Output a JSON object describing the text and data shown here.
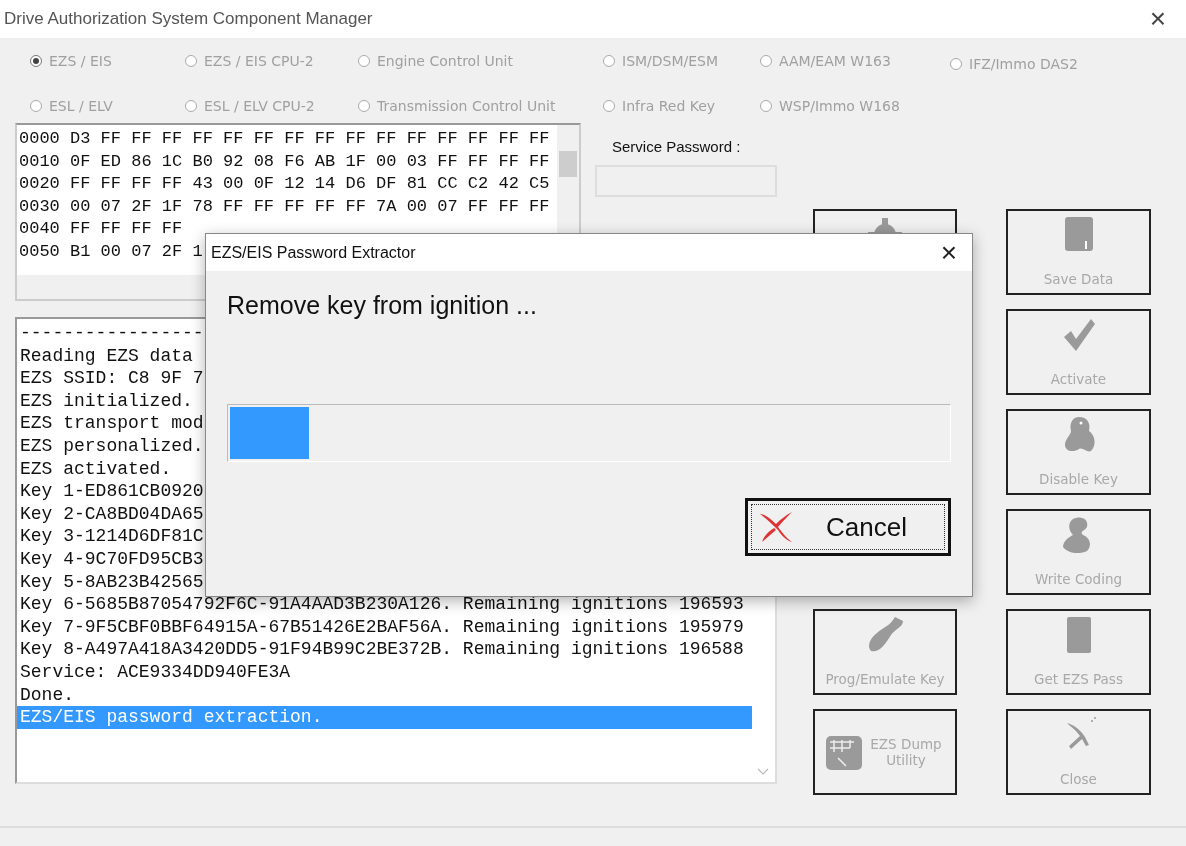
{
  "window": {
    "title": "Drive Authorization System Component Manager",
    "close": "×"
  },
  "modules": [
    {
      "label": "EZS / EIS",
      "selected": true,
      "disabled": true
    },
    {
      "label": "EZS / EIS CPU-2",
      "selected": false,
      "disabled": true
    },
    {
      "label": "Engine Control Unit",
      "selected": false,
      "disabled": true
    },
    {
      "label": "ISM/DSM/ESM",
      "selected": false,
      "disabled": true
    },
    {
      "label": "AAM/EAM W163",
      "selected": false,
      "disabled": true
    },
    {
      "label": "IFZ/Immo DAS2",
      "selected": false,
      "disabled": true
    },
    {
      "label": "ESL / ELV",
      "selected": false,
      "disabled": true
    },
    {
      "label": "ESL / ELV CPU-2",
      "selected": false,
      "disabled": true
    },
    {
      "label": "Transmission Control Unit",
      "selected": false,
      "disabled": true
    },
    {
      "label": "Infra Red Key",
      "selected": false,
      "disabled": true
    },
    {
      "label": "WSP/Immo W168",
      "selected": false,
      "disabled": true
    }
  ],
  "hex_dump": [
    "0000 D3 FF FF FF FF FF FF FF FF FF FF FF FF FF FF FF",
    "0010 0F ED 86 1C B0 92 08 F6 AB 1F 00 03 FF FF FF FF",
    "0020 FF FF FF FF 43 00 0F 12 14 D6 DF 81 CC C2 42 C5",
    "0030 00 07 2F 1F 78 FF FF FF FF FF 7A 00 07 FF FF FF",
    "0040 FF FF FF FF",
    "0050 B1 00 07 2F 1"
  ],
  "service_password": {
    "label": "Service Password :"
  },
  "log": [
    {
      "text": "-----------------",
      "selected": false
    },
    {
      "text": "Reading EZS data",
      "selected": false
    },
    {
      "text": "EZS SSID: C8 9F 7",
      "selected": false
    },
    {
      "text": "EZS initialized.",
      "selected": false
    },
    {
      "text": "EZS transport mod",
      "selected": false
    },
    {
      "text": "EZS personalized.",
      "selected": false
    },
    {
      "text": "EZS activated.",
      "selected": false
    },
    {
      "text": "Key 1-ED861CB0920",
      "selected": false
    },
    {
      "text": "Key 2-CA8BD04DA65",
      "selected": false
    },
    {
      "text": "Key 3-1214D6DF81C",
      "selected": false
    },
    {
      "text": "Key 4-9C70FD95CB3",
      "selected": false
    },
    {
      "text": "Key 5-8AB23B42565",
      "selected": false
    },
    {
      "text": "Key 6-5685B87054792F6C-91A4AAD3B230A126. Remaining ignitions 196593",
      "selected": false
    },
    {
      "text": "Key 7-9F5CBF0BBF64915A-67B51426E2BAF56A. Remaining ignitions 195979",
      "selected": false
    },
    {
      "text": "Key 8-A497A418A3420DD5-91F94B99C2BE372B. Remaining ignitions 196588",
      "selected": false
    },
    {
      "text": "Service: ACE9334DD940FE3A",
      "selected": false
    },
    {
      "text": "Done.",
      "selected": false
    },
    {
      "text": "EZS/EIS password extraction.",
      "selected": true
    }
  ],
  "middle_buttons": [
    {
      "kind": "icon-top",
      "disabled": true
    },
    {
      "kind": "icon-top",
      "label": "Prog/Emulate Key",
      "disabled": true
    },
    {
      "kind": "icon-left",
      "label": "EZS Dump Utility",
      "disabled": true
    }
  ],
  "right_buttons": [
    {
      "kind": "icon-top",
      "label": "Save Data",
      "disabled": true
    },
    {
      "kind": "icon-top",
      "label": "Activate",
      "disabled": true
    },
    {
      "kind": "icon-top",
      "label": "Disable Key",
      "disabled": true
    },
    {
      "kind": "icon-top",
      "label": "Write Coding",
      "disabled": true
    },
    {
      "kind": "icon-top",
      "label": "Get EZS Pass",
      "disabled": true
    },
    {
      "kind": "icon-top",
      "label": "Close",
      "disabled": true
    }
  ],
  "dialog": {
    "title": "EZS/EIS Password Extractor",
    "close": "×",
    "message": "Remove key from ignition ...",
    "progress": {
      "level": 0.11
    },
    "cancel": "Cancel"
  }
}
